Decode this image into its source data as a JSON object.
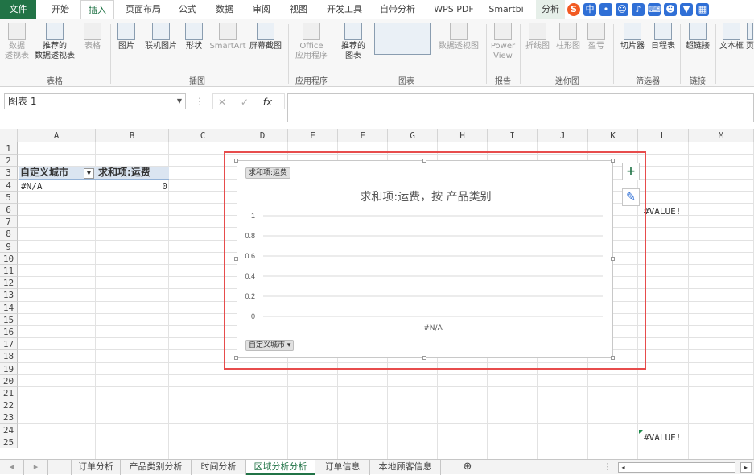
{
  "ribbon_tabs": [
    "文件",
    "开始",
    "插入",
    "页面布局",
    "公式",
    "数据",
    "审阅",
    "视图",
    "开发工具",
    "自带分析",
    "WPS PDF",
    "Smartbi",
    "分析"
  ],
  "ribbon": {
    "buttons": {
      "pivot": "数据\n透视表",
      "rec_pivot": "推荐的\n数据透视表",
      "table": "表格",
      "picture": "图片",
      "online_pic": "联机图片",
      "shapes": "形状",
      "smartart": "SmartArt",
      "screenshot": "屏幕截图",
      "office_apps": "Office\n应用程序",
      "rec_charts": "推荐的\n图表",
      "pivot_chart": "数据透视图",
      "power_view": "Power\nView",
      "line_spark": "折线图",
      "column_spark": "柱形图",
      "winloss": "盈亏",
      "slicer": "切片器",
      "timeline": "日程表",
      "hyperlink": "超链接",
      "textbox": "文本框",
      "more": "页"
    },
    "groups": [
      "表格",
      "插图",
      "应用程序",
      "图表",
      "报告",
      "迷你图",
      "筛选器",
      "链接"
    ]
  },
  "name_box": "图表 1",
  "formula_fx": "fx",
  "columns": [
    "A",
    "B",
    "C",
    "D",
    "E",
    "F",
    "G",
    "H",
    "I",
    "J",
    "K",
    "L",
    "M"
  ],
  "rows": [
    "1",
    "2",
    "3",
    "4",
    "5",
    "6",
    "7",
    "8",
    "9",
    "10",
    "11",
    "12",
    "13",
    "14",
    "15",
    "16",
    "17",
    "18",
    "19",
    "20",
    "21",
    "22",
    "23",
    "24",
    "25"
  ],
  "pivot": {
    "row_header": "自定义城市",
    "value_header": "求和项:运费",
    "row_label": "#N/A",
    "row_value": "0"
  },
  "cells": {
    "L6": "#VALUE!",
    "L24": "#VALUE!"
  },
  "chart": {
    "field_value_btn": "求和项:运费",
    "title": "求和项:运费，按 产品类别",
    "category_label": "#N/A",
    "axis_field_btn": "自定义城市",
    "plus_icon": "+",
    "brush_icon": "✎"
  },
  "chart_data": {
    "type": "bar",
    "title": "求和项:运费，按 产品类别",
    "categories": [
      "#N/A"
    ],
    "values": [
      0
    ],
    "y_ticks": [
      "1",
      "0.8",
      "0.6",
      "0.4",
      "0.2",
      "0"
    ],
    "ylim": [
      0,
      1
    ],
    "grid": true
  },
  "sheet_tabs": [
    "订单分析",
    "产品类别分析",
    "时间分析",
    "区域分析分析",
    "订单信息",
    "本地顾客信息"
  ],
  "active_sheet": "区域分析分析",
  "add_sheet": "⊕"
}
